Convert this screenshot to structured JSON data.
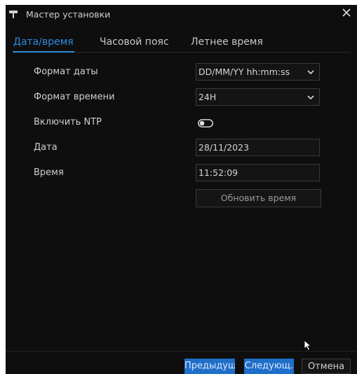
{
  "window": {
    "title": "Мастер установки"
  },
  "tabs": [
    {
      "label": "Дата/время",
      "active": true
    },
    {
      "label": "Часовой пояс",
      "active": false
    },
    {
      "label": "Летнее время",
      "active": false
    }
  ],
  "form": {
    "date_format": {
      "label": "Формат даты",
      "value": "DD/MM/YY hh:mm:ss"
    },
    "time_format": {
      "label": "Формат времени",
      "value": "24H"
    },
    "ntp": {
      "label": "Включить NTP",
      "enabled": false
    },
    "date": {
      "label": "Дата",
      "value": "28/11/2023"
    },
    "time": {
      "label": "Время",
      "value": "11:52:09"
    },
    "update_button": "Обновить время"
  },
  "footer": {
    "prev_label": "Предыдущ.",
    "next_label": "Следующ.",
    "cancel_label": "Отмена"
  },
  "icons": {
    "app": "wizard-icon",
    "close": "close-icon",
    "dropdown": "chevron-down-icon",
    "cursor": "mouse-pointer-icon"
  },
  "colors": {
    "background": "#0e0e0e",
    "accent": "#2f8be0",
    "primary_button": "#1f6ec7"
  }
}
